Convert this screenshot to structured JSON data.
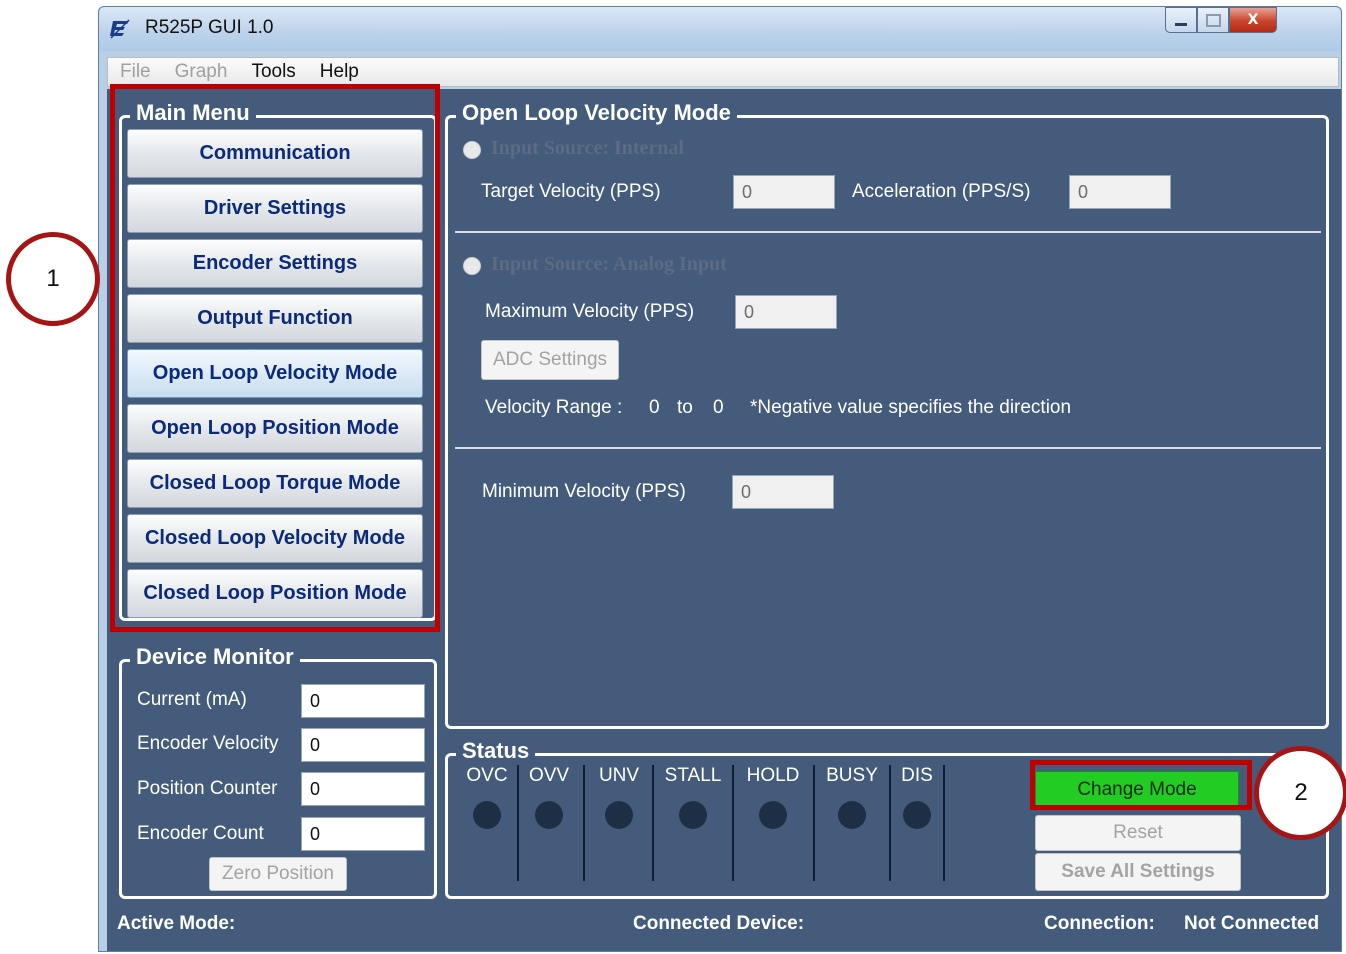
{
  "window": {
    "title": "R525P GUI 1.0",
    "minimize_icon": "minimize-icon",
    "maximize_icon": "maximize-icon",
    "close_icon": "close-icon",
    "close_glyph": "X"
  },
  "menubar": {
    "items": [
      "File",
      "Graph",
      "Tools",
      "Help"
    ]
  },
  "main_menu": {
    "title": "Main Menu",
    "buttons": [
      "Communication",
      "Driver Settings",
      "Encoder Settings",
      "Output Function",
      "Open Loop Velocity Mode",
      "Open Loop Position Mode",
      "Closed Loop Torque Mode",
      "Closed Loop Velocity Mode",
      "Closed Loop Position Mode"
    ],
    "active": "Open Loop Velocity Mode"
  },
  "device_monitor": {
    "title": "Device Monitor",
    "fields": [
      {
        "label": "Current (mA)",
        "value": "0"
      },
      {
        "label": "Encoder Velocity",
        "value": "0"
      },
      {
        "label": "Position Counter",
        "value": "0"
      },
      {
        "label": "Encoder Count",
        "value": "0"
      }
    ],
    "zero_button": "Zero Position"
  },
  "mode_panel": {
    "title": "Open Loop Velocity Mode",
    "internal": {
      "radio_label": "Input Source: Internal",
      "target_velocity_label": "Target Velocity (PPS)",
      "target_velocity_value": "0",
      "acceleration_label": "Acceleration (PPS/S)",
      "acceleration_value": "0"
    },
    "analog": {
      "radio_label": "Input Source: Analog Input",
      "max_velocity_label": "Maximum Velocity (PPS)",
      "max_velocity_value": "0",
      "adc_button": "ADC Settings",
      "range_label": "Velocity Range :",
      "range_from": "0",
      "range_to_label": "to",
      "range_to": "0",
      "range_note": "*Negative value specifies the direction"
    },
    "min_velocity_label": "Minimum Velocity (PPS)",
    "min_velocity_value": "0"
  },
  "status": {
    "title": "Status",
    "indicators": [
      "OVC",
      "OVV",
      "UNV",
      "STALL",
      "HOLD",
      "BUSY",
      "DIS"
    ],
    "led_color": "#1e2e45",
    "change_mode_button": "Change Mode",
    "change_mode_color": "#22cc22",
    "reset_button": "Reset",
    "save_button": "Save All Settings"
  },
  "footer": {
    "active_mode_label": "Active Mode:",
    "active_mode_value": "",
    "connected_device_label": "Connected Device:",
    "connected_device_value": "",
    "connection_label": "Connection:",
    "connection_value": "Not Connected"
  },
  "annotations": {
    "callout_1": "1",
    "callout_2": "2",
    "highlight_color": "#c00000"
  }
}
